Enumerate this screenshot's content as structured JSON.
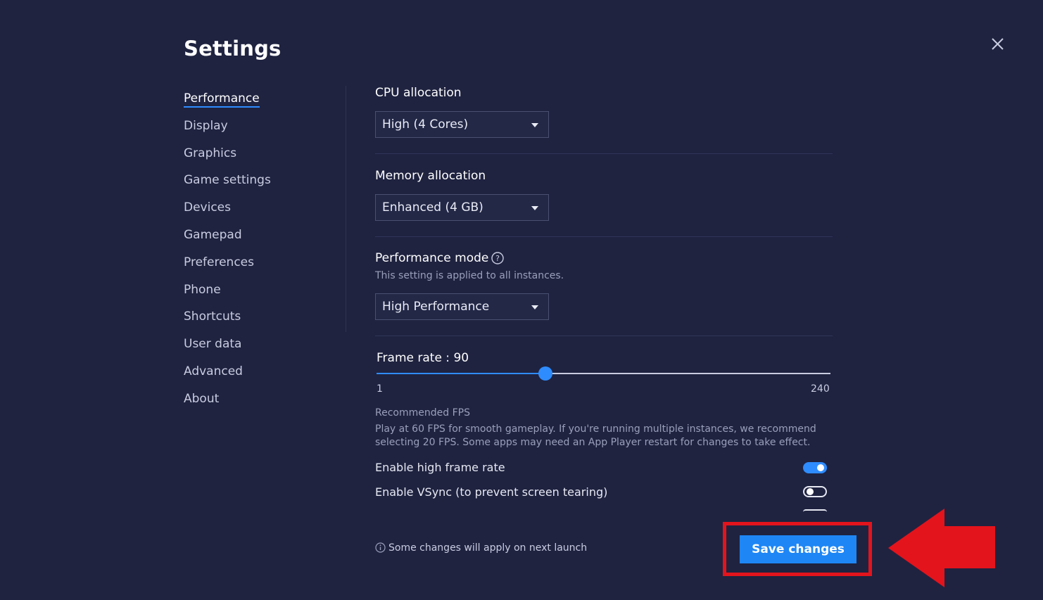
{
  "dialog": {
    "title": "Settings",
    "close_icon": "close-icon"
  },
  "nav": {
    "items": [
      {
        "label": "Performance",
        "active": true
      },
      {
        "label": "Display",
        "active": false
      },
      {
        "label": "Graphics",
        "active": false
      },
      {
        "label": "Game settings",
        "active": false
      },
      {
        "label": "Devices",
        "active": false
      },
      {
        "label": "Gamepad",
        "active": false
      },
      {
        "label": "Preferences",
        "active": false
      },
      {
        "label": "Phone",
        "active": false
      },
      {
        "label": "Shortcuts",
        "active": false
      },
      {
        "label": "User data",
        "active": false
      },
      {
        "label": "Advanced",
        "active": false
      },
      {
        "label": "About",
        "active": false
      }
    ]
  },
  "performance": {
    "cpu": {
      "label": "CPU allocation",
      "value": "High (4 Cores)"
    },
    "memory": {
      "label": "Memory allocation",
      "value": "Enhanced (4 GB)"
    },
    "mode": {
      "label": "Performance mode",
      "help_icon": "question-circle-icon",
      "note": "This setting is applied to all instances.",
      "value": "High Performance"
    },
    "frame_rate": {
      "label": "Frame rate : 90",
      "value": 90,
      "min": 1,
      "max": 240,
      "min_label": "1",
      "max_label": "240"
    },
    "recommended": {
      "title": "Recommended FPS",
      "text": "Play at 60 FPS for smooth gameplay. If you're running multiple instances, we recommend selecting 20 FPS. Some apps may need an App Player restart for changes to take effect."
    },
    "toggles": [
      {
        "label": "Enable high frame rate",
        "on": true
      },
      {
        "label": "Enable VSync (to prevent screen tearing)",
        "on": false
      }
    ]
  },
  "footer": {
    "info_icon": "info-circle-icon",
    "note": "Some changes will apply on next launch",
    "save_label": "Save changes"
  },
  "annotation": {
    "highlight_color": "#e3141c",
    "arrow_icon": "red-arrow-left-icon"
  },
  "colors": {
    "background": "#1f2340",
    "accent": "#2f8cff",
    "button": "#1e86f5"
  }
}
